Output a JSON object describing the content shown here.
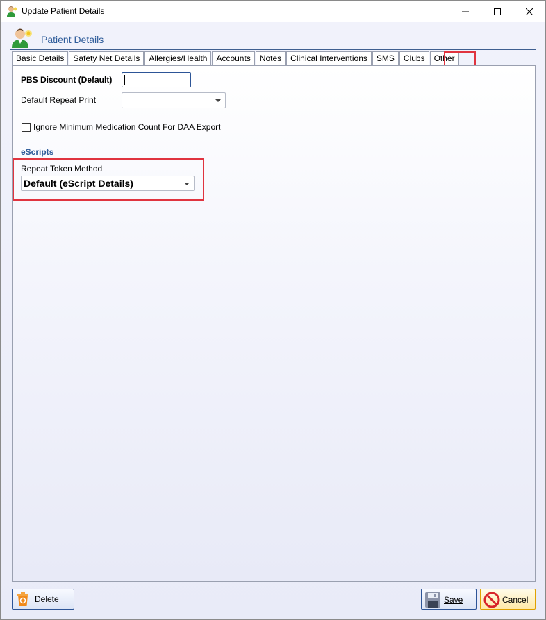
{
  "window": {
    "title": "Update Patient Details",
    "controls": [
      "minimize-icon",
      "maximize-icon",
      "close-icon"
    ]
  },
  "header": {
    "title": "Patient Details",
    "icon": "patient-avatar-icon"
  },
  "tabs": [
    {
      "label": "Basic Details"
    },
    {
      "label": "Safety Net Details"
    },
    {
      "label": "Allergies/Health"
    },
    {
      "label": "Accounts"
    },
    {
      "label": "Notes"
    },
    {
      "label": "Clinical Interventions"
    },
    {
      "label": "SMS"
    },
    {
      "label": "Clubs"
    },
    {
      "label": "Other",
      "active": true
    }
  ],
  "form": {
    "pbs_discount_label": "PBS Discount (Default)",
    "pbs_discount_value": "",
    "default_repeat_print_label": "Default Repeat Print",
    "default_repeat_print_value": "",
    "ignore_min_count_label": "Ignore Minimum Medication Count For DAA Export",
    "ignore_min_count_checked": false,
    "escripts_section": "eScripts",
    "repeat_token_method_label": "Repeat Token Method",
    "repeat_token_method_value": "Default (eScript Details)"
  },
  "footer": {
    "delete_label": "Delete",
    "save_label": "Save",
    "cancel_label": "Cancel"
  },
  "colors": {
    "accent": "#2e5c9a",
    "highlight": "#e0343f"
  }
}
